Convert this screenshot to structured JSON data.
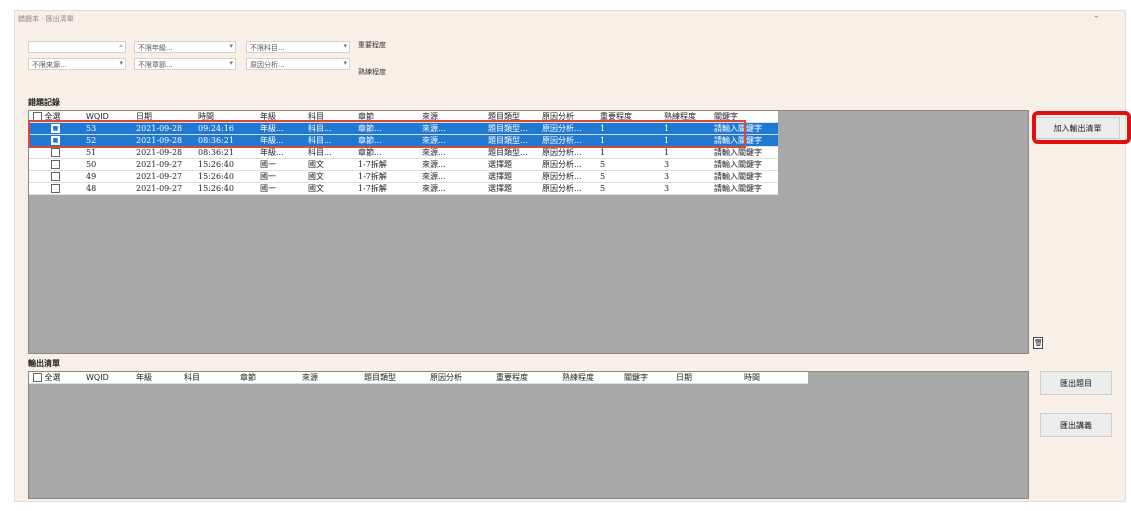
{
  "window": {
    "title": "錯題本 · 匯出清單",
    "minimize_icon": "minimize-icon"
  },
  "filters": {
    "search_value": "",
    "search_icon": "search-icon",
    "grade": "不限年級...",
    "subject": "不限科目...",
    "chapter": "不限章節...",
    "analysis": "原因分析...",
    "source": "不限來源...",
    "importance_label": "重要程度",
    "proficiency_label": "熟練程度",
    "importance_stars": "☆☆☆☆☆",
    "proficiency_stars": "☆☆☆☆☆"
  },
  "records": {
    "title": "錯題記錄",
    "columns": [
      "全選",
      "WQID",
      "日期",
      "時間",
      "年級",
      "科目",
      "章節",
      "來源",
      "題目類型",
      "原因分析",
      "重要程度",
      "熟練程度",
      "關鍵字"
    ],
    "rows": [
      {
        "checked": true,
        "selected": true,
        "wqid": "53",
        "date": "2021-09-28",
        "time": "09:24:16",
        "grade": "年級...",
        "subject": "科目...",
        "chapter": "章節...",
        "source": "來源...",
        "type": "題目類型...",
        "analysis": "原因分析...",
        "importance": "1",
        "proficiency": "1",
        "keyword": "請輸入關鍵字"
      },
      {
        "checked": true,
        "selected": true,
        "wqid": "52",
        "date": "2021-09-28",
        "time": "08:36:21",
        "grade": "年級...",
        "subject": "科目...",
        "chapter": "章節...",
        "source": "來源...",
        "type": "題目類型...",
        "analysis": "原因分析...",
        "importance": "1",
        "proficiency": "1",
        "keyword": "請輸入關鍵字"
      },
      {
        "checked": false,
        "selected": false,
        "wqid": "51",
        "date": "2021-09-28",
        "time": "08:36:21",
        "grade": "年級...",
        "subject": "科目...",
        "chapter": "章節...",
        "source": "來源...",
        "type": "題目類型...",
        "analysis": "原因分析...",
        "importance": "1",
        "proficiency": "1",
        "keyword": "請輸入關鍵字"
      },
      {
        "checked": false,
        "selected": false,
        "wqid": "50",
        "date": "2021-09-27",
        "time": "15:26:40",
        "grade": "國一",
        "subject": "國文",
        "chapter": "1-7拆解",
        "source": "來源...",
        "type": "選擇題",
        "analysis": "原因分析...",
        "importance": "5",
        "proficiency": "3",
        "keyword": "請輸入關鍵字"
      },
      {
        "checked": false,
        "selected": false,
        "wqid": "49",
        "date": "2021-09-27",
        "time": "15:26:40",
        "grade": "國一",
        "subject": "國文",
        "chapter": "1-7拆解",
        "source": "來源...",
        "type": "選擇題",
        "analysis": "原因分析...",
        "importance": "5",
        "proficiency": "3",
        "keyword": "請輸入關鍵字"
      },
      {
        "checked": false,
        "selected": false,
        "wqid": "48",
        "date": "2021-09-27",
        "time": "15:26:40",
        "grade": "國一",
        "subject": "國文",
        "chapter": "1-7拆解",
        "source": "來源...",
        "type": "選擇題",
        "analysis": "原因分析...",
        "importance": "5",
        "proficiency": "3",
        "keyword": "請輸入關鍵字"
      }
    ]
  },
  "add_to_output_label": "加入輸出清單",
  "delete_icon": "trash-icon",
  "output": {
    "title": "輸出清單",
    "columns": [
      "全選",
      "WQID",
      "年級",
      "科目",
      "章節",
      "來源",
      "題目類型",
      "原因分析",
      "重要程度",
      "熟練程度",
      "關鍵字",
      "日期",
      "時間"
    ]
  },
  "export_questions_label": "匯出題目",
  "export_notes_label": "匯出講義",
  "colors": {
    "selection": "#1f78d1",
    "highlight_border": "#e01010",
    "background": "#f8efe6",
    "grid": "#a8a8a8"
  }
}
